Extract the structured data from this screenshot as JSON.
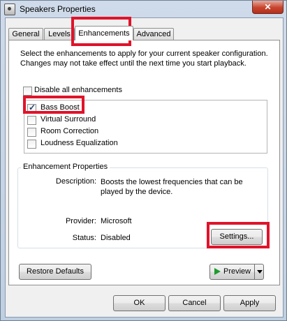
{
  "window": {
    "title": "Speakers Properties",
    "close_label": "✕"
  },
  "tabs": [
    {
      "label": "General"
    },
    {
      "label": "Levels"
    },
    {
      "label": "Enhancements"
    },
    {
      "label": "Advanced"
    }
  ],
  "active_tab": "Enhancements",
  "description": "Select the enhancements to apply for your current speaker configuration. Changes may not take effect until the next time you start playback.",
  "disable_all": {
    "label": "Disable all enhancements",
    "checked": false
  },
  "enhancements": [
    {
      "label": "Bass Boost",
      "checked": true
    },
    {
      "label": "Virtual Surround",
      "checked": false
    },
    {
      "label": "Room Correction",
      "checked": false
    },
    {
      "label": "Loudness Equalization",
      "checked": false
    }
  ],
  "properties": {
    "group_title": "Enhancement Properties",
    "description_label": "Description:",
    "description_value": "Boosts the lowest frequencies that can be played by the device.",
    "provider_label": "Provider:",
    "provider_value": "Microsoft",
    "status_label": "Status:",
    "status_value": "Disabled",
    "settings_button": "Settings..."
  },
  "restore_defaults": "Restore Defaults",
  "preview": "Preview",
  "footer": {
    "ok": "OK",
    "cancel": "Cancel",
    "apply": "Apply"
  },
  "highlight_color": "#e0132a"
}
